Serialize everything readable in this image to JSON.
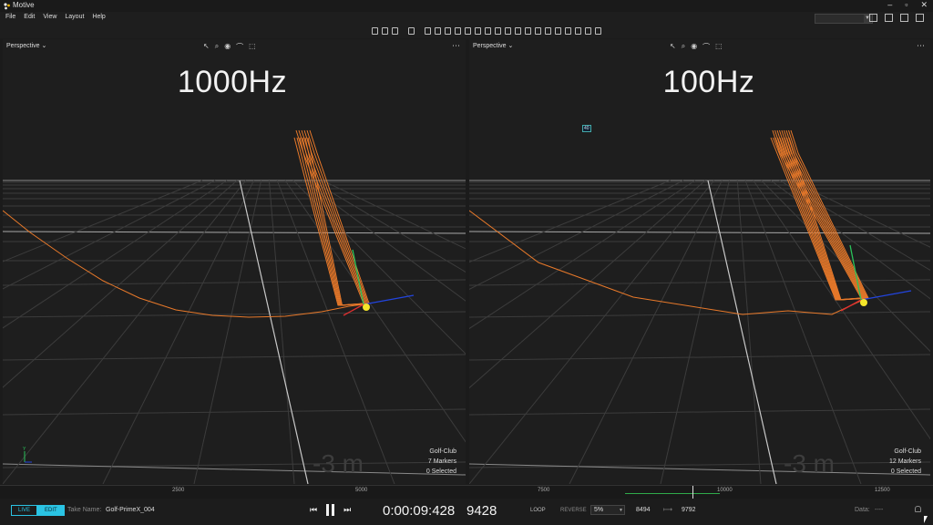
{
  "window": {
    "title": "Motive",
    "buttons": [
      "–",
      "▫",
      "✕"
    ]
  },
  "menu": [
    "File",
    "Edit",
    "View",
    "Layout",
    "Help"
  ],
  "colors": {
    "trace": "#e8792a",
    "grid": "#3c3c3c",
    "gridBright": "#c8c8c8",
    "accent": "#2ac3e3",
    "marker": "#f5e62a",
    "axisX": "#2244dd",
    "axisY": "#2ac35a",
    "axisZ": "#e03030"
  },
  "viewports": [
    {
      "view": "Perspective",
      "title": "1000Hz",
      "info": {
        "asset": "Golf-Club",
        "markers": "7 Markers",
        "selected": "0 Selected"
      },
      "tools": [
        "↖",
        "⌕",
        "◉",
        "⌒",
        "⬚"
      ]
    },
    {
      "view": "Perspective",
      "title": "100Hz",
      "badge": "40",
      "info": {
        "asset": "Golf-Club",
        "markers": "12 Markers",
        "selected": "0 Selected"
      },
      "tools": [
        "↖",
        "⌕",
        "◉",
        "⌒",
        "⬚"
      ]
    }
  ],
  "timeline": {
    "ticks": [
      "2500",
      "5000",
      "7500",
      "10000",
      "12500"
    ]
  },
  "controls": {
    "live": "LIVE",
    "edit": "EDIT",
    "take_label": "Take Name:",
    "take_name": "Golf-PrimeX_004",
    "timecode": "0:00:09:428",
    "frame": "9428",
    "loop": "LOOP",
    "reverse": "REVERSE",
    "speed": "5%",
    "start_frame": "8494",
    "end_frame": "9792",
    "data_label": "Data:",
    "data_value": "----"
  }
}
